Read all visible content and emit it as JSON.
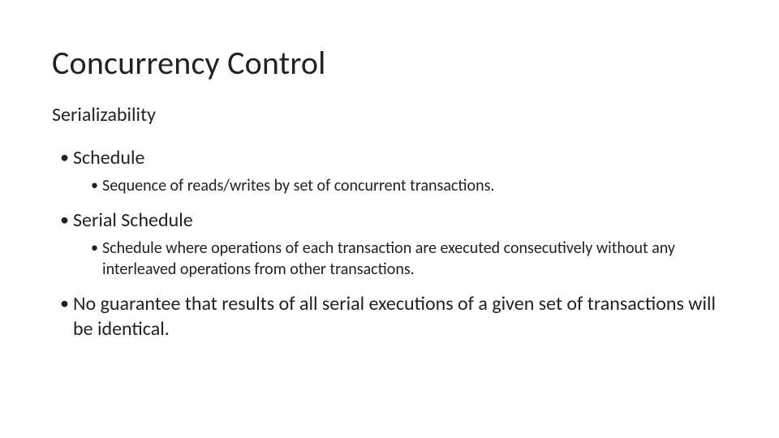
{
  "title": "Concurrency Control",
  "subtitle": "Serializability",
  "bullets": {
    "b1": "Schedule",
    "b1a": "Sequence of reads/writes by set of concurrent transactions.",
    "b2": "Serial Schedule",
    "b2a": "Schedule where operations of each transaction are executed consecutively without any interleaved operations from other transactions.",
    "b3": "No guarantee that results of all serial executions of a given set of transactions will be identical."
  }
}
